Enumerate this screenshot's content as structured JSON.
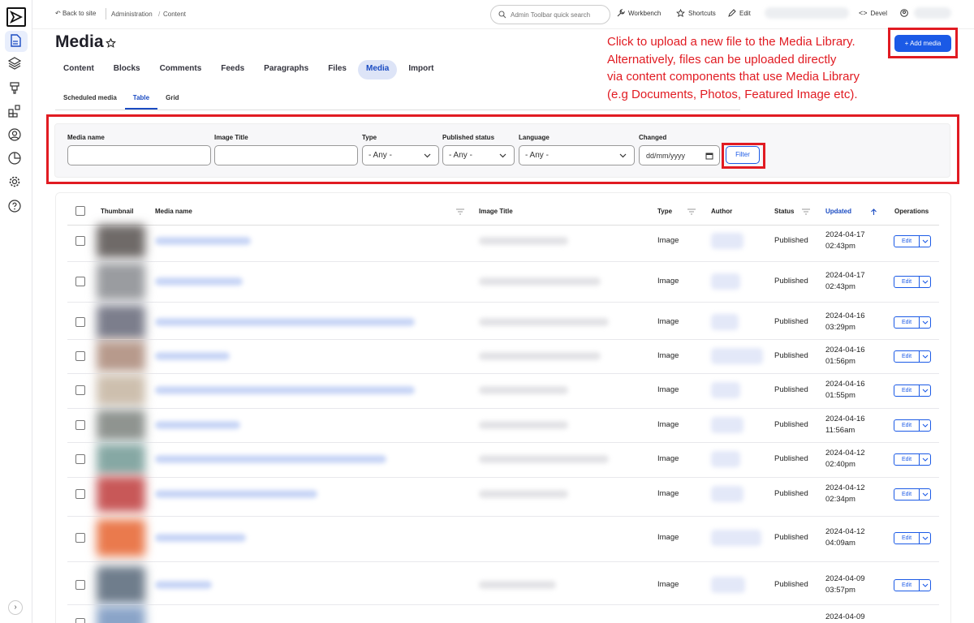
{
  "topbar": {
    "back": "Back to site",
    "crumbs": [
      "Administration",
      "Content"
    ],
    "search_placeholder": "Admin Toolbar quick search",
    "workbench": "Workbench",
    "shortcuts": "Shortcuts",
    "edit": "Edit",
    "devel": "Devel"
  },
  "page": {
    "title": "Media"
  },
  "primary_tabs": [
    "Content",
    "Blocks",
    "Comments",
    "Feeds",
    "Paragraphs",
    "Files",
    "Media",
    "Import"
  ],
  "secondary_tabs": [
    "Scheduled media",
    "Table",
    "Grid"
  ],
  "annotation": {
    "lines": [
      "Click to upload a new file to the Media Library.",
      "Alternatively, files can be uploaded directly",
      "via content components that use Media Library",
      "(e.g Documents, Photos, Featured Image etc)."
    ]
  },
  "add_media": "+ Add media",
  "filters": {
    "media_name": "Media name",
    "image_title": "Image Title",
    "type": "Type",
    "type_value": "- Any -",
    "published": "Published status",
    "published_value": "- Any -",
    "language": "Language",
    "language_value": "- Any -",
    "changed": "Changed",
    "changed_placeholder": "dd/mm/yyyy",
    "filter_button": "Filter"
  },
  "table": {
    "headers": {
      "thumbnail": "Thumbnail",
      "media_name": "Media name",
      "image_title": "Image Title",
      "type": "Type",
      "author": "Author",
      "status": "Status",
      "updated": "Updated",
      "operations": "Operations"
    },
    "rows": [
      {
        "type": "Image",
        "status": "Published",
        "date": "2024-04-17",
        "time": "02:43pm",
        "edit": "Edit"
      },
      {
        "type": "Image",
        "status": "Published",
        "date": "2024-04-17",
        "time": "02:43pm",
        "edit": "Edit"
      },
      {
        "type": "Image",
        "status": "Published",
        "date": "2024-04-16",
        "time": "03:29pm",
        "edit": "Edit"
      },
      {
        "type": "Image",
        "status": "Published",
        "date": "2024-04-16",
        "time": "01:56pm",
        "edit": "Edit"
      },
      {
        "type": "Image",
        "status": "Published",
        "date": "2024-04-16",
        "time": "01:55pm",
        "edit": "Edit"
      },
      {
        "type": "Image",
        "status": "Published",
        "date": "2024-04-16",
        "time": "11:56am",
        "edit": "Edit"
      },
      {
        "type": "Image",
        "status": "Published",
        "date": "2024-04-12",
        "time": "02:40pm",
        "edit": "Edit"
      },
      {
        "type": "Image",
        "status": "Published",
        "date": "2024-04-12",
        "time": "02:34pm",
        "edit": "Edit"
      },
      {
        "type": "Image",
        "status": "Published",
        "date": "2024-04-12",
        "time": "04:09am",
        "edit": "Edit"
      },
      {
        "type": "Image",
        "status": "Published",
        "date": "2024-04-09",
        "time": "03:57pm",
        "edit": "Edit"
      },
      {
        "date": "2024-04-09"
      }
    ]
  },
  "colors": {
    "accent": "#1b5ae6",
    "annotation": "#e11b22"
  },
  "icons": [
    "logo-icon",
    "content-icon",
    "structure-icon",
    "appearance-icon",
    "extend-icon",
    "people-icon",
    "reports-icon",
    "config-icon",
    "help-icon"
  ]
}
